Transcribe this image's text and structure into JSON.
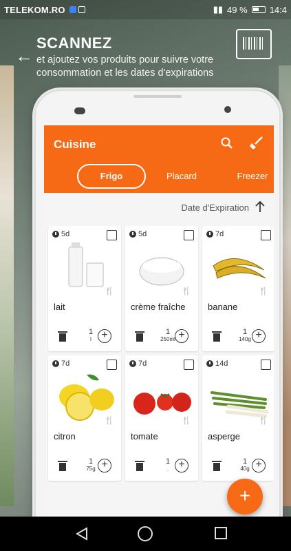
{
  "status": {
    "carrier": "TELEKOM.RO",
    "battery": "49 %",
    "time": "14:4"
  },
  "banner": {
    "title": "SCANNEZ",
    "subtitle": "et ajoutez vos produits pour suivre votre consommation et les dates d'expirations"
  },
  "app": {
    "title": "Cuisine",
    "tabs": [
      "Frigo",
      "Placard",
      "Freezer"
    ],
    "sort_label": "Date d'Expiration"
  },
  "products": [
    {
      "name": "lait",
      "days": "5d",
      "qty": "1",
      "unit": "l"
    },
    {
      "name": "crème fraîche",
      "days": "5d",
      "qty": "1",
      "unit": "250ml"
    },
    {
      "name": "banane",
      "days": "7d",
      "qty": "1",
      "unit": "140g"
    },
    {
      "name": "citron",
      "days": "7d",
      "qty": "1",
      "unit": "75g"
    },
    {
      "name": "tomate",
      "days": "7d",
      "qty": "1",
      "unit": "."
    },
    {
      "name": "asperge",
      "days": "14d",
      "qty": "1",
      "unit": "40g"
    }
  ],
  "icons": {
    "back": "arrow-left-icon",
    "scan": "barcode-scan-icon",
    "search": "search-icon",
    "clean": "broom-icon",
    "sort": "arrow-up-icon",
    "add": "plus-icon"
  },
  "colors": {
    "accent": "#f76a15"
  }
}
